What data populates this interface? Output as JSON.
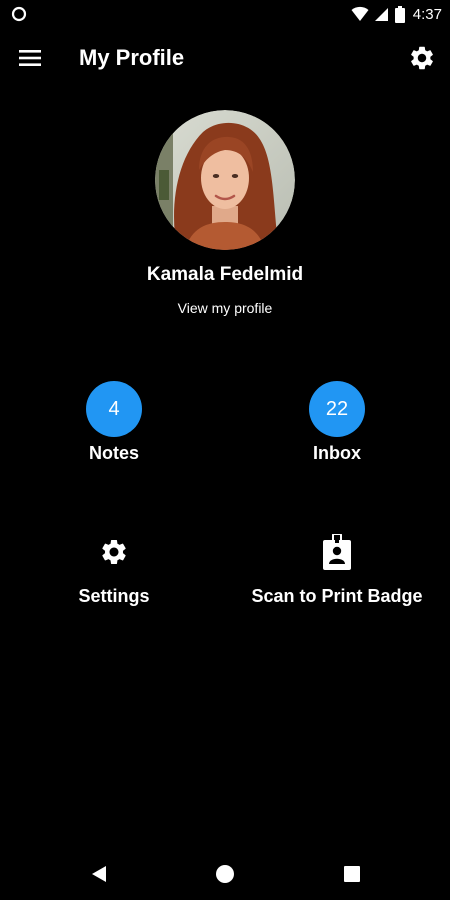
{
  "status_bar": {
    "time": "4:37",
    "left_icon": "record-icon",
    "right_icons": [
      "wifi-icon",
      "signal-icon",
      "battery-icon"
    ]
  },
  "app_bar": {
    "title": "My Profile",
    "menu_icon": "menu-icon",
    "settings_icon": "gear-icon"
  },
  "profile": {
    "name": "Kamala Fedelmid",
    "view_profile_label": "View my profile"
  },
  "counts": [
    {
      "label": "Notes",
      "count": "4"
    },
    {
      "label": "Inbox",
      "count": "22"
    }
  ],
  "actions": [
    {
      "label": "Settings",
      "icon": "gear-icon"
    },
    {
      "label": "Scan to Print Badge",
      "icon": "badge-icon"
    }
  ],
  "nav_bar": {
    "icons": [
      "back-icon",
      "home-icon",
      "recents-icon"
    ]
  },
  "colors": {
    "background": "#000000",
    "text": "#FFFFFF",
    "accent": "#2196F3"
  }
}
